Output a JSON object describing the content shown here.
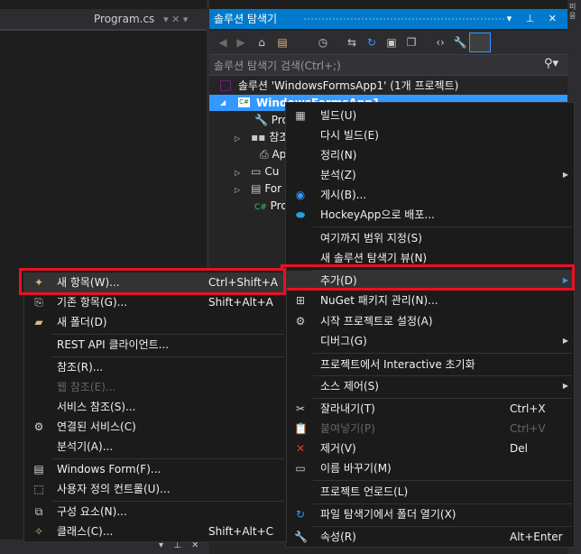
{
  "editor": {
    "tab_label": "Program.cs",
    "tab_icons": "▾ ✕ ▾"
  },
  "solution_explorer": {
    "title": "솔루션 탐색기",
    "title_buttons": "▾ ⊥ ✕",
    "search_placeholder": "솔루션 탐색기 검색(Ctrl+;)",
    "search_icon": "🔍",
    "toolbar_icons": [
      "back-icon",
      "forward-icon",
      "home-icon",
      "switch-views-icon",
      "history-icon",
      "sync-icon",
      "refresh-icon",
      "collapse-all-icon",
      "show-all-files-icon",
      "view-code-icon",
      "properties-icon",
      "preview-icon"
    ],
    "solution_row": "솔루션 'WindowsFormsApp1' (1개 프로젝트)",
    "project_row": "WindowsFormsApp1",
    "tree_partials": [
      "Pro",
      "참조",
      "Ap",
      "Cu",
      "For",
      "Pro"
    ]
  },
  "right_strip": {
    "lines": [
      "미",
      "응"
    ]
  },
  "context_menu": {
    "items": [
      {
        "label": "빌드(U)",
        "shortcut": "",
        "icon": "build-icon"
      },
      {
        "label": "다시 빌드(E)",
        "shortcut": "",
        "icon": ""
      },
      {
        "label": "정리(N)",
        "shortcut": "",
        "icon": ""
      },
      {
        "label": "분석(Z)",
        "shortcut": "",
        "icon": "",
        "submenu": true
      },
      {
        "label": "게시(B)...",
        "shortcut": "",
        "icon": "globe-icon"
      },
      {
        "label": "HockeyApp으로 배포...",
        "shortcut": "",
        "icon": "hockeyapp-icon"
      },
      {
        "label": "여기까지 범위 지정(S)",
        "shortcut": "",
        "icon": ""
      },
      {
        "label": "새 솔루션 탐색기 뷰(N)",
        "shortcut": "",
        "icon": ""
      },
      {
        "label": "추가(D)",
        "shortcut": "",
        "icon": "",
        "submenu": true
      },
      {
        "label": "NuGet 패키지 관리(N)...",
        "shortcut": "",
        "icon": "nuget-icon"
      },
      {
        "label": "시작 프로젝트로 설정(A)",
        "shortcut": "",
        "icon": "gear-icon"
      },
      {
        "label": "디버그(G)",
        "shortcut": "",
        "icon": "",
        "submenu": true
      },
      {
        "label": "프로젝트에서 Interactive 초기화",
        "shortcut": "",
        "icon": ""
      },
      {
        "label": "소스 제어(S)",
        "shortcut": "",
        "icon": "",
        "submenu": true
      },
      {
        "label": "잘라내기(T)",
        "shortcut": "Ctrl+X",
        "icon": "scissors-icon"
      },
      {
        "label": "붙여넣기(P)",
        "shortcut": "Ctrl+V",
        "icon": "paste-icon",
        "disabled": true
      },
      {
        "label": "제거(V)",
        "shortcut": "Del",
        "icon": "remove-icon"
      },
      {
        "label": "이름 바꾸기(M)",
        "shortcut": "",
        "icon": "rename-icon"
      },
      {
        "label": "프로젝트 언로드(L)",
        "shortcut": "",
        "icon": ""
      },
      {
        "label": "파일 탐색기에서 폴더 열기(X)",
        "shortcut": "",
        "icon": "refresh-icon"
      },
      {
        "label": "속성(R)",
        "shortcut": "Alt+Enter",
        "icon": "wrench-icon"
      }
    ]
  },
  "submenu": {
    "items": [
      {
        "label": "새 항목(W)...",
        "shortcut": "Ctrl+Shift+A",
        "icon": "new-item-icon"
      },
      {
        "label": "기존 항목(G)...",
        "shortcut": "Shift+Alt+A",
        "icon": "existing-item-icon"
      },
      {
        "label": "새 폴더(D)",
        "shortcut": "",
        "icon": "new-folder-icon"
      },
      {
        "label": "REST API 클라이언트...",
        "shortcut": "",
        "icon": ""
      },
      {
        "label": "참조(R)...",
        "shortcut": "",
        "icon": ""
      },
      {
        "label": "웹 참조(E)...",
        "shortcut": "",
        "icon": "",
        "disabled": true
      },
      {
        "label": "서비스 참조(S)...",
        "shortcut": "",
        "icon": ""
      },
      {
        "label": "연결된 서비스(C)",
        "shortcut": "",
        "icon": "connected-service-icon"
      },
      {
        "label": "분석기(A)...",
        "shortcut": "",
        "icon": ""
      },
      {
        "label": "Windows Form(F)...",
        "shortcut": "",
        "icon": "windows-form-icon"
      },
      {
        "label": "사용자 정의 컨트롤(U)...",
        "shortcut": "",
        "icon": "user-control-icon"
      },
      {
        "label": "구성 요소(N)...",
        "shortcut": "",
        "icon": "component-icon"
      },
      {
        "label": "클래스(C)...",
        "shortcut": "Shift+Alt+C",
        "icon": "class-icon"
      }
    ]
  },
  "bottom": {
    "icons": "▾ ⊥ ✕"
  }
}
